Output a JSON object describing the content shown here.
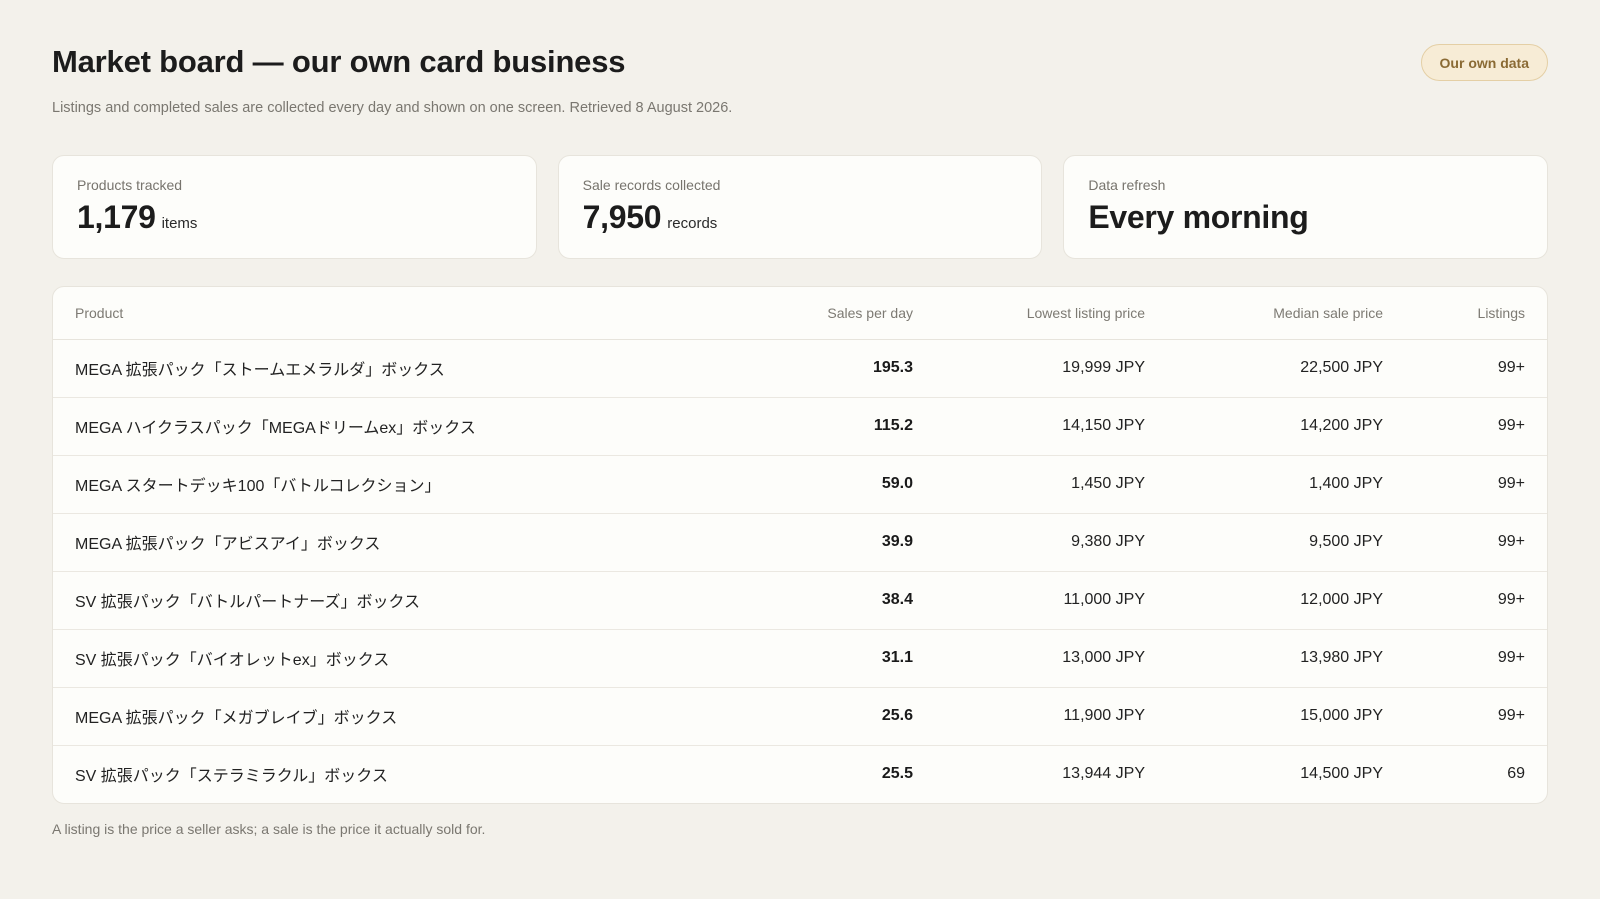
{
  "header": {
    "title": "Market board — our own card business",
    "subtitle": "Listings and completed sales are collected every day and shown on one screen. Retrieved 8 August 2026.",
    "badge": "Our own data"
  },
  "stats": [
    {
      "label": "Products tracked",
      "value": "1,179",
      "unit": "items"
    },
    {
      "label": "Sale records collected",
      "value": "7,950",
      "unit": "records"
    },
    {
      "label": "Data refresh",
      "value": "Every morning",
      "unit": ""
    }
  ],
  "table": {
    "columns": [
      "Product",
      "Sales per day",
      "Lowest listing price",
      "Median sale price",
      "Listings"
    ],
    "rows": [
      [
        "MEGA 拡張パック「ストームエメラルダ」ボックス",
        "195.3",
        "19,999 JPY",
        "22,500 JPY",
        "99+"
      ],
      [
        "MEGA ハイクラスパック「MEGAドリームex」ボックス",
        "115.2",
        "14,150 JPY",
        "14,200 JPY",
        "99+"
      ],
      [
        "MEGA スタートデッキ100「バトルコレクション」",
        "59.0",
        "1,450 JPY",
        "1,400 JPY",
        "99+"
      ],
      [
        "MEGA 拡張パック「アビスアイ」ボックス",
        "39.9",
        "9,380 JPY",
        "9,500 JPY",
        "99+"
      ],
      [
        "SV 拡張パック「バトルパートナーズ」ボックス",
        "38.4",
        "11,000 JPY",
        "12,000 JPY",
        "99+"
      ],
      [
        "SV 拡張パック「バイオレットex」ボックス",
        "31.1",
        "13,000 JPY",
        "13,980 JPY",
        "99+"
      ],
      [
        "MEGA 拡張パック「メガブレイブ」ボックス",
        "25.6",
        "11,900 JPY",
        "15,000 JPY",
        "99+"
      ],
      [
        "SV 拡張パック「ステラミラクル」ボックス",
        "25.5",
        "13,944 JPY",
        "14,500 JPY",
        "69"
      ]
    ]
  },
  "footnote": "A listing is the price a seller asks; a sale is the price it actually sold for.",
  "colors": {
    "background": "#f3f1eb",
    "card": "#fdfdfa",
    "badge_bg": "#f7ecd6",
    "badge_text": "#8a6a34"
  }
}
